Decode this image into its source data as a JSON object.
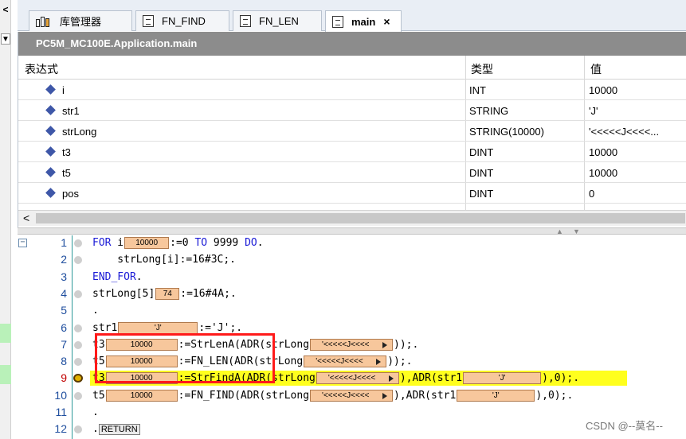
{
  "tabs": [
    {
      "label": "库管理器",
      "icon": "library-icon"
    },
    {
      "label": "FN_FIND",
      "icon": "document-icon"
    },
    {
      "label": "FN_LEN",
      "icon": "document-icon"
    },
    {
      "label": "main",
      "icon": "document-icon",
      "close": "×"
    }
  ],
  "watch": {
    "title": "PC5M_MC100E.Application.main",
    "headers": {
      "expr": "表达式",
      "type": "类型",
      "value": "值"
    },
    "rows": [
      {
        "name": "i",
        "type": "INT",
        "value": "10000"
      },
      {
        "name": "str1",
        "type": "STRING",
        "value": "'J'"
      },
      {
        "name": "strLong",
        "type": "STRING(10000)",
        "value": "'<<<<<J<<<<..."
      },
      {
        "name": "t3",
        "type": "DINT",
        "value": "10000"
      },
      {
        "name": "t5",
        "type": "DINT",
        "value": "10000"
      },
      {
        "name": "pos",
        "type": "DINT",
        "value": "0"
      }
    ],
    "scroll_left": "<"
  },
  "editor": {
    "collapse": "−",
    "lines": [
      {
        "n": "1",
        "a": "FOR",
        "b": " i",
        "mv": "10000",
        "c": ":=0 ",
        "d": "TO",
        "e": " 9999 ",
        "f": "DO",
        "g": "."
      },
      {
        "n": "2",
        "text": "    strLong[i]:=16#3C;."
      },
      {
        "n": "3",
        "kw": "END_FOR",
        "text": "."
      },
      {
        "n": "4",
        "pre": "strLong[5]",
        "mv": "74",
        "post": ":=16#4A;."
      },
      {
        "n": "5",
        "text": "."
      },
      {
        "n": "6",
        "pre": "str1",
        "mv": "'J'",
        "post": ":='J';."
      },
      {
        "n": "7",
        "pre": "t3",
        "mv": "10000",
        "mid": ":=StrLenA(ADR(strLong",
        "mv2": "'<<<<<J<<<<",
        "post": "));."
      },
      {
        "n": "8",
        "pre": "t5",
        "mv": "10000",
        "mid": ":=FN_LEN(ADR(strLong",
        "mv2": "'<<<<<J<<<<",
        "post": "));."
      },
      {
        "n": "9",
        "pre": "t3",
        "mv": "10000",
        "mid": ":=StrFindA(ADR(strLong",
        "mv2": "'<<<<<J<<<<",
        "mid2": "),ADR(str1",
        "mv3": "'J'",
        "post": "),0);."
      },
      {
        "n": "10",
        "pre": "t5",
        "mv": "10000",
        "mid": ":=FN_FIND(ADR(strLong",
        "mv2": "'<<<<<J<<<<",
        "mid2": "),ADR(str1",
        "mv3": "'J'",
        "post": "),0);."
      },
      {
        "n": "11",
        "text": "."
      },
      {
        "n": "12",
        "text": ".",
        "ret": "RETURN"
      }
    ]
  },
  "left": {
    "arrow": "<",
    "dropdown": "▼"
  },
  "watermark": "CSDN @--莫名--",
  "colors": {
    "highlight": "#ffff1e",
    "monitor": "#f7c79c",
    "keyword": "#1b1bd6",
    "redbox": "#ff1a1a"
  }
}
